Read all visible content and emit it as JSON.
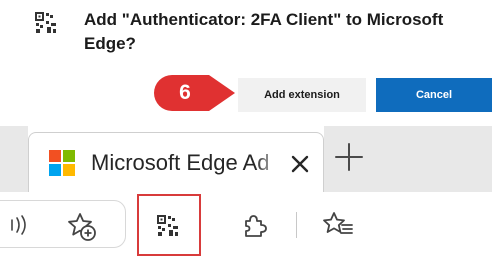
{
  "dialog": {
    "icon": "authenticator-qr-icon",
    "title": "Add \"Authenticator: 2FA Client\" to Microsoft Edge?",
    "add_label": "Add extension",
    "cancel_label": "Cancel"
  },
  "annotation": {
    "step": "6",
    "color": "#e03131"
  },
  "browser": {
    "tab_title": "Microsoft Edge Ad",
    "tab_close_icon": "close-icon",
    "new_tab_icon": "plus-icon",
    "toolbar_icons": [
      "read-aloud-icon",
      "add-favorite-icon",
      "authenticator-extension-icon",
      "extensions-puzzle-icon",
      "favorites-icon"
    ]
  },
  "colors": {
    "accent": "#0f6cbd",
    "highlight": "#d83b3b",
    "ms_red": "#f25022",
    "ms_green": "#7fba00",
    "ms_blue": "#00a4ef",
    "ms_yellow": "#ffb900"
  }
}
